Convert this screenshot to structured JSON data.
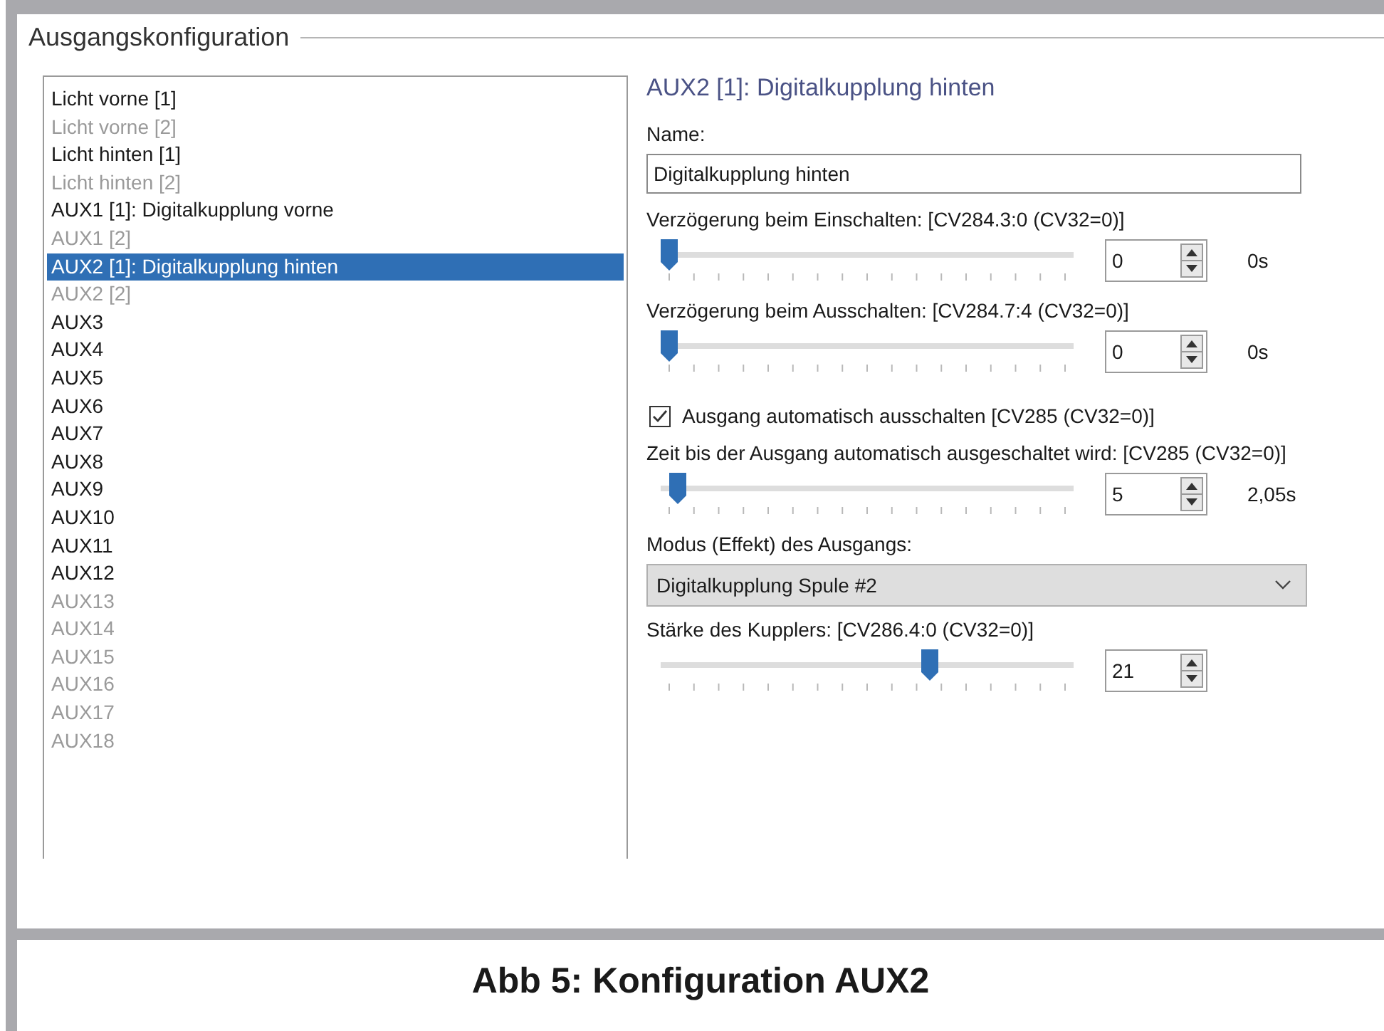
{
  "group_box": {
    "title": "Ausgangskonfiguration"
  },
  "outputs": [
    {
      "label": "Licht vorne [1]",
      "disabled": false,
      "selected": false
    },
    {
      "label": "Licht vorne [2]",
      "disabled": true,
      "selected": false
    },
    {
      "label": "Licht hinten [1]",
      "disabled": false,
      "selected": false
    },
    {
      "label": "Licht hinten [2]",
      "disabled": true,
      "selected": false
    },
    {
      "label": "AUX1 [1]: Digitalkupplung vorne",
      "disabled": false,
      "selected": false
    },
    {
      "label": "AUX1 [2]",
      "disabled": true,
      "selected": false
    },
    {
      "label": "AUX2 [1]: Digitalkupplung hinten",
      "disabled": false,
      "selected": true
    },
    {
      "label": "AUX2 [2]",
      "disabled": true,
      "selected": false
    },
    {
      "label": "AUX3",
      "disabled": false,
      "selected": false
    },
    {
      "label": "AUX4",
      "disabled": false,
      "selected": false
    },
    {
      "label": "AUX5",
      "disabled": false,
      "selected": false
    },
    {
      "label": "AUX6",
      "disabled": false,
      "selected": false
    },
    {
      "label": "AUX7",
      "disabled": false,
      "selected": false
    },
    {
      "label": "AUX8",
      "disabled": false,
      "selected": false
    },
    {
      "label": "AUX9",
      "disabled": false,
      "selected": false
    },
    {
      "label": "AUX10",
      "disabled": false,
      "selected": false
    },
    {
      "label": "AUX11",
      "disabled": false,
      "selected": false
    },
    {
      "label": "AUX12",
      "disabled": false,
      "selected": false
    },
    {
      "label": "AUX13",
      "disabled": true,
      "selected": false
    },
    {
      "label": "AUX14",
      "disabled": true,
      "selected": false
    },
    {
      "label": "AUX15",
      "disabled": true,
      "selected": false
    },
    {
      "label": "AUX16",
      "disabled": true,
      "selected": false
    },
    {
      "label": "AUX17",
      "disabled": true,
      "selected": false
    },
    {
      "label": "AUX18",
      "disabled": true,
      "selected": false
    }
  ],
  "detail": {
    "title": "AUX2 [1]: Digitalkupplung hinten",
    "name_label": "Name:",
    "name_value": "Digitalkupplung hinten",
    "settings": [
      {
        "kind": "slider",
        "label": "Verzögerung beim Einschalten: [CV284.3:0 (CV32=0)]",
        "level": 0,
        "value": "0",
        "reading": "0s"
      },
      {
        "kind": "slider",
        "label": "Verzögerung beim Ausschalten: [CV284.7:4 (CV32=0)]",
        "level": 0,
        "value": "0",
        "reading": "0s"
      },
      {
        "kind": "checkbox",
        "label": "Ausgang automatisch ausschalten [CV285 (CV32=0)]",
        "checked": true
      },
      {
        "kind": "slider",
        "label": "Zeit bis der Ausgang automatisch ausgeschaltet wird: [CV285 (CV32=0)]",
        "level": 0.02,
        "value": "5",
        "reading": "2,05s"
      },
      {
        "kind": "dropdown",
        "label": "Modus (Effekt) des Ausgangs:",
        "value": "Digitalkupplung Spule #2"
      },
      {
        "kind": "slider",
        "label": "Stärke des Kupplers: [CV286.4:0 (CV32=0)]",
        "level": 0.66,
        "value": "21"
      }
    ]
  },
  "caption": "Abb 5: Konfiguration AUX2"
}
